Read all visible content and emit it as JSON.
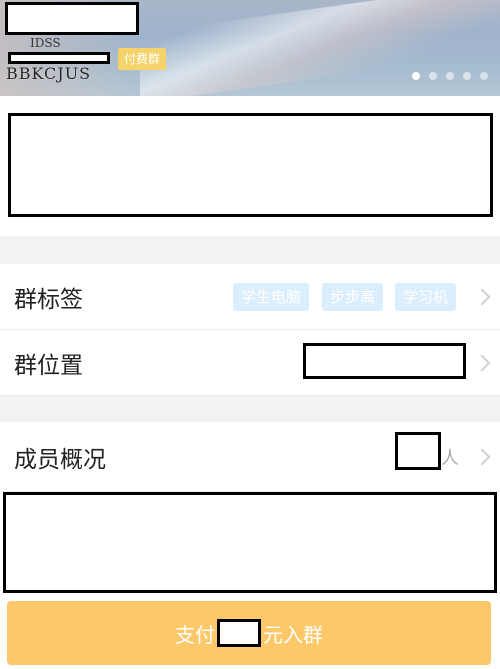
{
  "banner": {
    "avatar_text": "IDSS",
    "group_code": "BBKCJUS",
    "paid_badge": "付费群",
    "carousel_dots": 5,
    "active_dot": 1
  },
  "rows": {
    "tags": {
      "label": "群标签",
      "items": [
        "学生电脑",
        "步步高",
        "学习机"
      ]
    },
    "location": {
      "label": "群位置"
    },
    "members": {
      "label": "成员概况",
      "unit": "人"
    }
  },
  "pay_button": {
    "prefix": "支付",
    "suffix": "元入群"
  },
  "colors": {
    "accent_button": "#fdc86a",
    "tag_bg": "#dbeefe",
    "badge_bg": "#f5d36a"
  }
}
